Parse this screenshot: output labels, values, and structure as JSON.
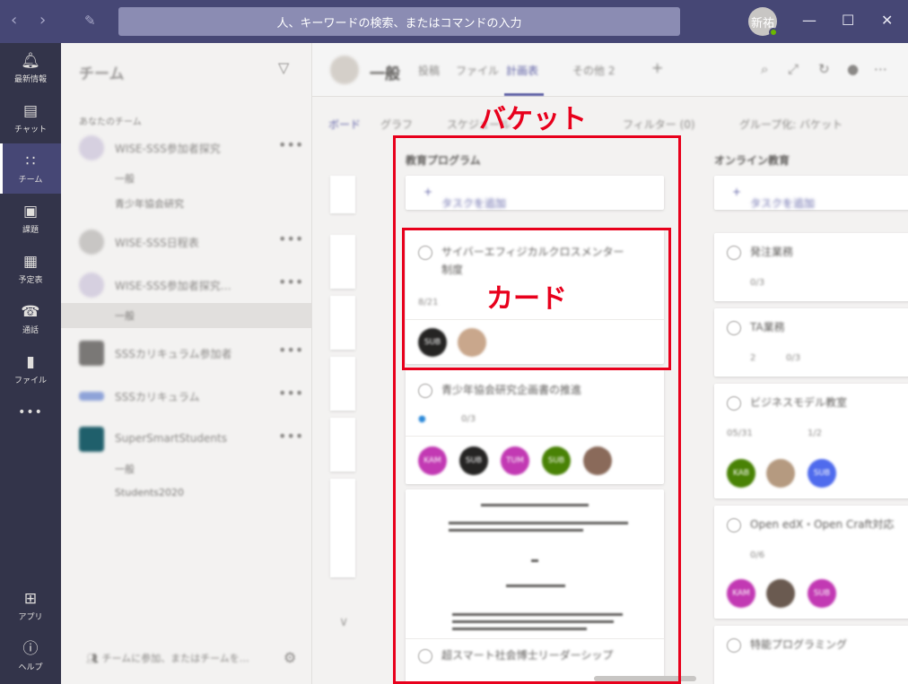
{
  "titlebar": {
    "back_icon": "chevron-left-icon",
    "forward_icon": "chevron-right-icon",
    "compose_icon": "compose-icon",
    "search_placeholder": "人、キーワードの検索、またはコマンドの入力",
    "avatar_initials": "新祐",
    "presence_color": "#6bb700",
    "min_glyph": "—",
    "max_glyph": "☐",
    "close_glyph": "✕"
  },
  "rail": {
    "items": [
      {
        "label": "最新情報",
        "icon": "bell-icon"
      },
      {
        "label": "チャット",
        "icon": "chat-icon"
      },
      {
        "label": "チーム",
        "icon": "teams-icon"
      },
      {
        "label": "課題",
        "icon": "backpack-icon"
      },
      {
        "label": "予定表",
        "icon": "calendar-icon"
      },
      {
        "label": "通話",
        "icon": "phone-icon"
      },
      {
        "label": "ファイル",
        "icon": "file-icon"
      }
    ],
    "more": "•••",
    "bottom": [
      {
        "label": "アプリ",
        "icon": "apps-icon"
      },
      {
        "label": "ヘルプ",
        "icon": "help-icon"
      }
    ],
    "active_color": "#464775"
  },
  "teams_pane": {
    "title": "チーム",
    "section": "あなたのチーム",
    "teams": [
      {
        "name": "WISE-SSS参加者探究",
        "channels": [
          "一般",
          "青少年協会研究"
        ]
      },
      {
        "name": "WISE-SSS日程表",
        "channels": []
      },
      {
        "name": "WISE-SSS参加者探究…",
        "channels": [
          "一般"
        ]
      },
      {
        "name": "SSSカリキュラム参加者",
        "channels": []
      },
      {
        "name": "SSSカリキュラム",
        "channels": []
      },
      {
        "name": "SuperSmartStudents",
        "channels": [
          "一般",
          "Students2020"
        ]
      }
    ],
    "more_glyph": "•••",
    "join_label": "チームに参加、またはチームを…"
  },
  "channel_header": {
    "name": "一般",
    "tabs": [
      "投稿",
      "ファイル",
      "計画表",
      "その他 2"
    ],
    "active_tab": "計画表",
    "add_glyph": "+"
  },
  "toolbar": {
    "board": "ボード",
    "chart": "グラフ",
    "schedule": "スケジュール",
    "filter": "フィルター (0)",
    "group": "グループ化: バケット"
  },
  "annotations": {
    "bucket": "バケット",
    "card": "カード",
    "color": "#e8001c"
  },
  "buckets": [
    {
      "name": "教育プログラム",
      "add_task": "タスクを追加",
      "cards": [
        {
          "title_lines": [
            "サイバーエフィジカルクロスメンター",
            "制度"
          ],
          "meta": [
            "8/21"
          ],
          "assignees": [
            "SUB",
            ""
          ]
        },
        {
          "title_lines": [
            "青少年協会研究企画書の推進"
          ],
          "meta": [
            "0/3"
          ],
          "assignees": [
            "KAM",
            "SUB",
            "TUM",
            "SUB",
            ""
          ]
        },
        {
          "title_lines": [
            "超スマート社会博士リーダーシップ"
          ],
          "meta": [],
          "assignees": []
        }
      ]
    },
    {
      "name": "オンライン教育",
      "add_task": "タスクを追加",
      "cards": [
        {
          "title_lines": [
            "発注業務"
          ],
          "meta": [
            "0/3"
          ],
          "assignees": []
        },
        {
          "title_lines": [
            "TA業務"
          ],
          "meta": [
            "2",
            "0/3"
          ],
          "assignees": []
        },
        {
          "title_lines": [
            "ビジネスモデル教室"
          ],
          "meta": [
            "05/31",
            "1/2"
          ],
          "assignees": [
            "KAB",
            "",
            "SUB"
          ]
        },
        {
          "title_lines": [
            "Open edX・Open Craft対応"
          ],
          "meta": [
            "0/6"
          ],
          "assignees": [
            "KAM",
            "",
            "SUB"
          ]
        },
        {
          "title_lines": [
            "特能プログラミング"
          ],
          "meta": [],
          "assignees": []
        }
      ]
    }
  ]
}
